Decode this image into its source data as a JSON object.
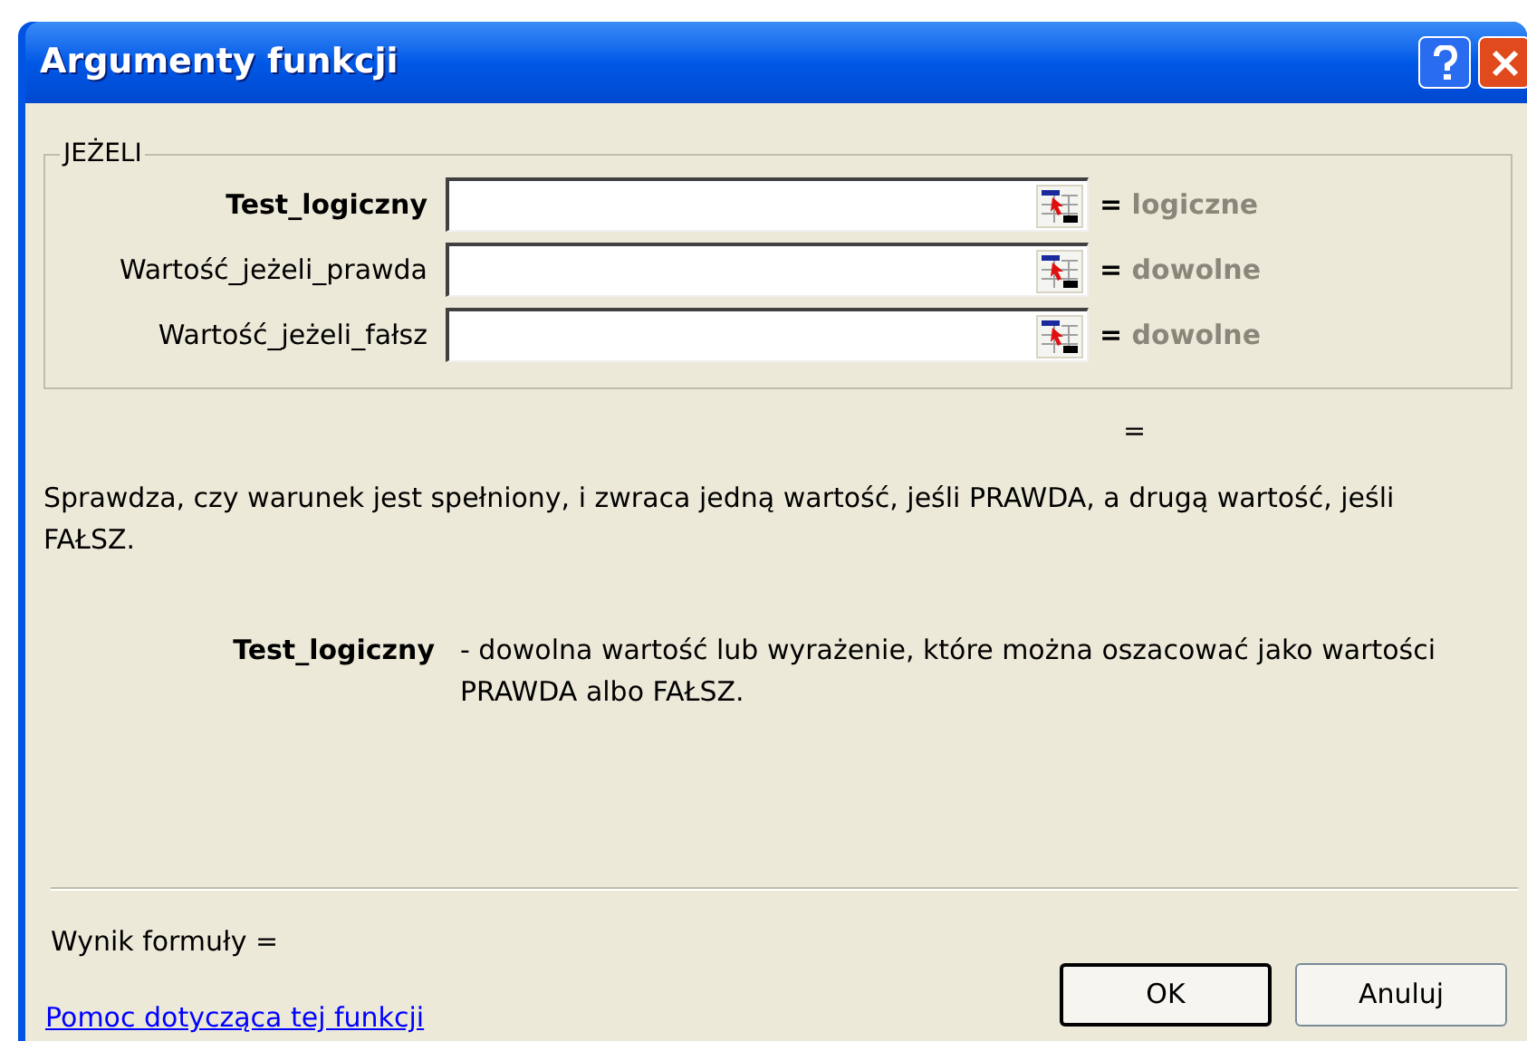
{
  "window": {
    "title": "Argumenty funkcji"
  },
  "function_group": {
    "legend": "JEŻELI",
    "arguments": [
      {
        "name": "Test_logiczny",
        "current": true,
        "result": "= ",
        "type_hint": "logiczne"
      },
      {
        "name": "Wartość_jeżeli_prawda",
        "current": false,
        "result": "= ",
        "type_hint": "dowolne"
      },
      {
        "name": "Wartość_jeżeli_fałsz",
        "current": false,
        "result": "= ",
        "type_hint": "dowolne"
      }
    ]
  },
  "function_result": "=",
  "description": "Sprawdza, czy warunek jest spełniony, i zwraca jedną wartość, jeśli PRAWDA, a drugą wartość, jeśli FAŁSZ.",
  "argument_help": {
    "name": "Test_logiczny",
    "text": "- dowolna wartość lub wyrażenie, które można oszacować jako wartości PRAWDA albo FAŁSZ."
  },
  "formula_result": "Wynik formuły =",
  "help_link": "Pomoc dotycząca tej funkcji",
  "buttons": [
    {
      "label": "OK",
      "default": true
    },
    {
      "label": "Anuluj",
      "default": false
    }
  ]
}
